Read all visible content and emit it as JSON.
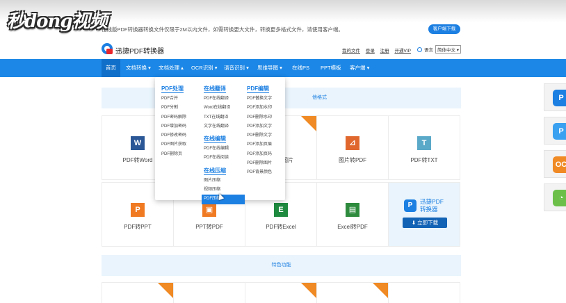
{
  "watermark": "秒dong视频",
  "topbar": {
    "notice": "在线版PDF转换器转换文件仅限于2M以内文件，如需转换更大文件，转换更多格式文件，请使用客户端。",
    "client_button": "客户端下载"
  },
  "header": {
    "logo_text": "迅捷PDF转换器",
    "links": [
      "我的文件",
      "登录",
      "注册",
      "开通VIP"
    ],
    "lang_label": "语言",
    "lang_value": "简体中文 ▾"
  },
  "nav": [
    {
      "label": "首页",
      "active": true
    },
    {
      "label": "文档转换 ▾"
    },
    {
      "label": "文档处理 ▴"
    },
    {
      "label": "OCR识别 ▾"
    },
    {
      "label": "语音识别 ▾"
    },
    {
      "label": "思维导图 ▾"
    },
    {
      "label": "在线PS"
    },
    {
      "label": "PPT模板"
    },
    {
      "label": "客户端 ▾"
    }
  ],
  "dropdown": {
    "col1": {
      "head": "PDF处理",
      "items": [
        "PDF合并",
        "PDF分割",
        "PDF密码解除",
        "PDF增加密码",
        "PDF修改密码",
        "PDF图片获取",
        "PDF删除页"
      ]
    },
    "col2": {
      "head1": "在线翻译",
      "items1": [
        "PDF在线翻译",
        "Word在线翻译",
        "TXT在线翻译",
        "文字在线翻译"
      ],
      "head2": "在线编辑",
      "items2": [
        "PDF在线编辑",
        "PDF在线阅读"
      ],
      "head3": "在线压缩",
      "items3": [
        "图片压缩",
        "视频压缩",
        "PDF压缩"
      ]
    },
    "col3": {
      "head": "PDF编辑",
      "items": [
        "PDF替换文字",
        "PDF添加水印",
        "PDF删除水印",
        "PDF添加文字",
        "PDF删除文字",
        "PDF添加页眉",
        "PDF添加页码",
        "PDF删除图片",
        "PDF背景颜色"
      ]
    }
  },
  "banners": {
    "top_tail": "他格式",
    "features": "特色功能"
  },
  "tools_row1": [
    {
      "label": "PDF转Word",
      "icon": "W",
      "color": "#2b5797"
    },
    {
      "label": "",
      "icon": "",
      "color": ""
    },
    {
      "label": "图片",
      "icon": "",
      "color": ""
    },
    {
      "label": "图片转PDF",
      "icon": "⊿",
      "color": "#e0682e"
    },
    {
      "label": "PDF转TXT",
      "icon": "T",
      "color": "#5aa9c9"
    }
  ],
  "tools_row2": [
    {
      "label": "PDF转PPT",
      "icon": "P",
      "color": "#f07a22"
    },
    {
      "label": "PPT转PDF",
      "icon": "▣",
      "color": "#f07a22"
    },
    {
      "label": "PDF转Excel",
      "icon": "E",
      "color": "#1e8a3f"
    },
    {
      "label": "Excel转PDF",
      "icon": "▤",
      "color": "#2e8b3e"
    }
  ],
  "promo": {
    "logo": "P",
    "line1": "迅捷PDF",
    "line2": "转换器",
    "button": "⬇ 立即下载"
  },
  "side_icons": [
    {
      "icon": "P",
      "color": "#1c7fe2"
    },
    {
      "icon": "P",
      "color": "#3aa0f0"
    },
    {
      "icon": "OC",
      "color": "#f08a24"
    },
    {
      "icon": "◔",
      "color": "#6cc04a"
    }
  ]
}
